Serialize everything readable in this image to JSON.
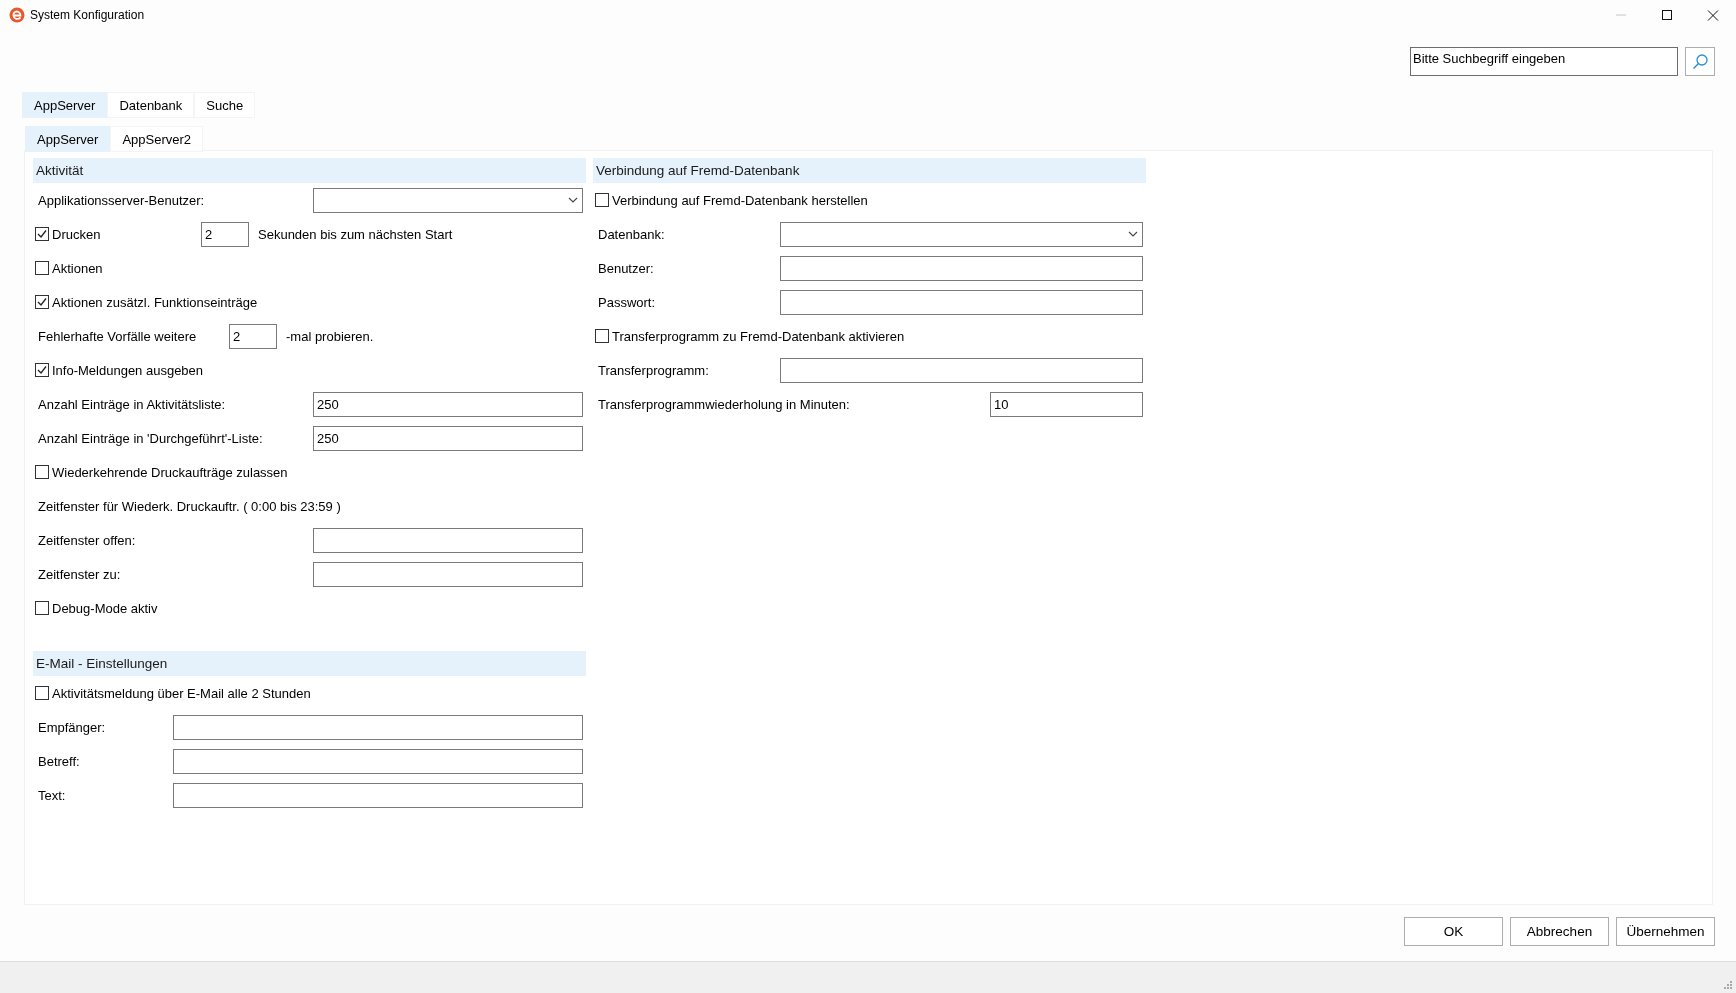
{
  "window": {
    "title": "System Konfiguration"
  },
  "search": {
    "value": "Bitte Suchbegriff eingeben"
  },
  "tabs": [
    {
      "label": "AppServer",
      "selected": true
    },
    {
      "label": "Datenbank",
      "selected": false
    },
    {
      "label": "Suche",
      "selected": false
    }
  ],
  "subtabs": [
    {
      "label": "AppServer",
      "selected": true
    },
    {
      "label": "AppServer2",
      "selected": false
    }
  ],
  "columns": [
    {
      "sections": [
        {
          "title": "Aktivität",
          "rows": [
            {
              "kind": "select",
              "label": "Applikationsserver-Benutzer:"
            },
            {
              "kind": "check_spin",
              "label": "Drucken",
              "checked": true,
              "value": "2",
              "suffix": "Sekunden bis zum nächsten Start"
            },
            {
              "kind": "check",
              "label": "Aktionen",
              "checked": false
            },
            {
              "kind": "check",
              "label": "Aktionen zusätzl. Funktionseinträge",
              "checked": true
            },
            {
              "kind": "spin",
              "label": "Fehlerhafte Vorfälle weitere",
              "value": "2",
              "suffix": "-mal probieren."
            },
            {
              "kind": "check",
              "label": "Info-Meldungen ausgeben",
              "checked": true
            },
            {
              "kind": "field",
              "label": "Anzahl Einträge in Aktivitätsliste:",
              "value": "250"
            },
            {
              "kind": "field",
              "label": "Anzahl Einträge in 'Durchgeführt'-Liste:",
              "value": "250"
            },
            {
              "kind": "check",
              "label": "Wiederkehrende Druckaufträge zulassen",
              "checked": false
            },
            {
              "kind": "note",
              "label": "Zeitfenster für Wiederk. Druckauftr.  ( 0:00 bis 23:59 )"
            },
            {
              "kind": "field",
              "label": "Zeitfenster offen:"
            },
            {
              "kind": "field",
              "label": "Zeitfenster zu:"
            },
            {
              "kind": "check",
              "label": "Debug-Mode aktiv",
              "checked": false
            }
          ]
        },
        {
          "title": "E-Mail - Einstellungen",
          "rows": [
            {
              "kind": "check",
              "label": "Aktivitätsmeldung über E-Mail alle 2 Stunden",
              "checked": false
            },
            {
              "kind": "field",
              "label": "Empfänger:"
            },
            {
              "kind": "field",
              "label": "Betreff:"
            },
            {
              "kind": "field",
              "label": "Text:"
            }
          ]
        }
      ]
    },
    {
      "sections": [
        {
          "title": "Verbindung auf Fremd-Datenbank",
          "rows": [
            {
              "kind": "check",
              "label": "Verbindung auf Fremd-Datenbank herstellen",
              "checked": false
            },
            {
              "kind": "select",
              "label": "Datenbank:"
            },
            {
              "kind": "field",
              "label": "Benutzer:"
            },
            {
              "kind": "field",
              "label": "Passwort:"
            },
            {
              "kind": "check",
              "label": "Transferprogramm zu Fremd-Datenbank aktivieren",
              "checked": false
            },
            {
              "kind": "field",
              "label": "Transferprogramm:"
            },
            {
              "kind": "short_field",
              "label": "Transferprogrammwiederholung in Minuten:",
              "value": "10"
            }
          ]
        }
      ]
    }
  ],
  "buttons": [
    "OK",
    "Abbrechen",
    "Übernehmen"
  ]
}
